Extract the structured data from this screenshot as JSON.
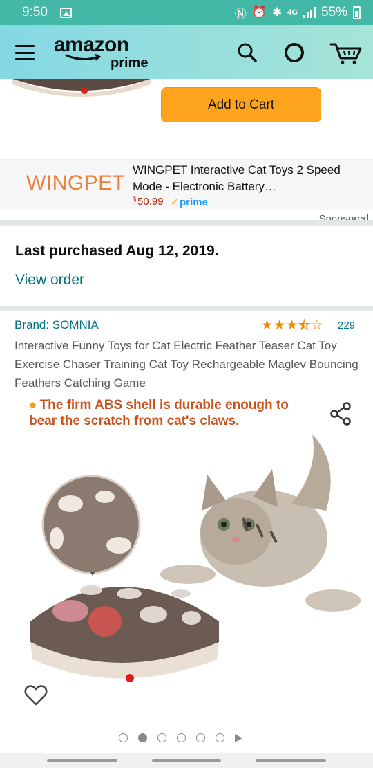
{
  "status_bar": {
    "time": "9:50",
    "battery": "55%",
    "network": "4G"
  },
  "header": {
    "logo_amazon": "amazon",
    "logo_prime": "prime",
    "icons": [
      "menu-icon",
      "search-icon",
      "alexa-icon",
      "cart-icon"
    ]
  },
  "buy_box": {
    "add_to_cart_label": "Add to Cart",
    "button_color": "#ffa41c"
  },
  "sponsored_ad": {
    "brand_logo": "WINGPET",
    "title": "WINGPET Interactive Cat Toys 2 Speed Mode - Electronic Battery…",
    "price_symbol": "$",
    "price": "50.99",
    "prime_label": "prime",
    "sponsored_label": "Sponsored"
  },
  "purchase_history": {
    "text": "Last purchased Aug 12, 2019.",
    "link": "View order"
  },
  "product": {
    "brand": "Brand: SOMNIA",
    "rating": 3.5,
    "rating_max": 5,
    "review_count": "229",
    "title": "Interactive Funny Toys for Cat Electric Feather Teaser Cat Toy Exercise Chaser Training Cat Toy Rechargeable Maglev Bouncing Feathers Catching Game",
    "image_caption": "The firm ABS shell is durable enough to bear the scratch from cat's claws.",
    "image_count": 6,
    "active_image": 2
  },
  "colors": {
    "link": "#007185",
    "nav_gradient_start": "#84d8e3",
    "nav_gradient_end": "#a6e4d8",
    "status_bar": "#43b8a6",
    "price": "#b12704",
    "star": "#f08804"
  }
}
